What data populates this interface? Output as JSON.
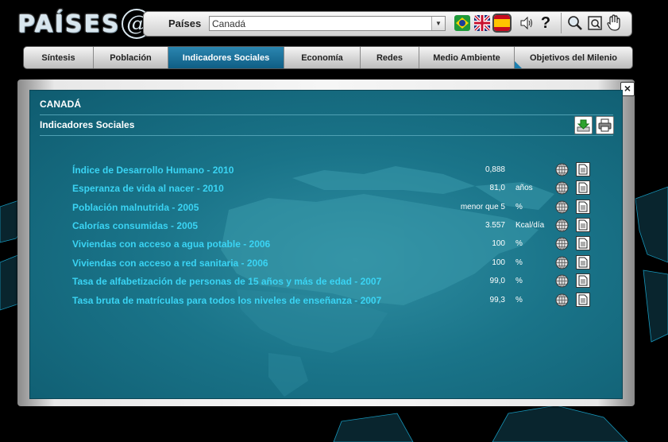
{
  "app": {
    "logo_text": "PAÍSES",
    "logo_mark": "@"
  },
  "search": {
    "label": "Países",
    "selected_country": "Canadá"
  },
  "languages": [
    {
      "name": "Português",
      "icon": "brazil-flag-icon"
    },
    {
      "name": "English",
      "icon": "uk-flag-icon"
    },
    {
      "name": "Español",
      "icon": "spain-flag-icon",
      "selected": true
    }
  ],
  "tools": [
    "sound-icon",
    "help-icon",
    "zoom-icon",
    "fit-view-icon",
    "pan-hand-icon"
  ],
  "tabs": [
    {
      "label": "Síntesis"
    },
    {
      "label": "Población"
    },
    {
      "label": "Indicadores Sociales",
      "active": true
    },
    {
      "label": "Economía"
    },
    {
      "label": "Redes"
    },
    {
      "label": "Medio Ambiente"
    },
    {
      "label": "Objetivos del Milenio"
    }
  ],
  "panel": {
    "country": "CANADÁ",
    "section": "Indicadores Sociales",
    "close_label": "×"
  },
  "indicators": [
    {
      "name": "Índice de Desarrollo Humano - 2010",
      "value": "0,888",
      "unit": ""
    },
    {
      "name": "Esperanza de vida al nacer - 2010",
      "value": "81,0",
      "unit": "años"
    },
    {
      "name": "Población malnutrida - 2005",
      "value": "menor que 5",
      "unit": "%"
    },
    {
      "name": "Calorías consumidas - 2005",
      "value": "3.557",
      "unit": "Kcal/día"
    },
    {
      "name": "Viviendas con acceso a agua potable - 2006",
      "value": "100",
      "unit": "%"
    },
    {
      "name": "Viviendas con acceso a red sanitaria - 2006",
      "value": "100",
      "unit": "%"
    },
    {
      "name": "Tasa de alfabetización de personas de 15 años y más de edad - 2007",
      "value": "99,0",
      "unit": "%"
    },
    {
      "name": "Tasa bruta de matrículas para todos los niveles de enseñanza - 2007",
      "value": "99,3",
      "unit": "%"
    }
  ],
  "colors": {
    "accent": "#3ad4f4",
    "panel": "#1a7489",
    "tab_active": "#1b6f98"
  }
}
